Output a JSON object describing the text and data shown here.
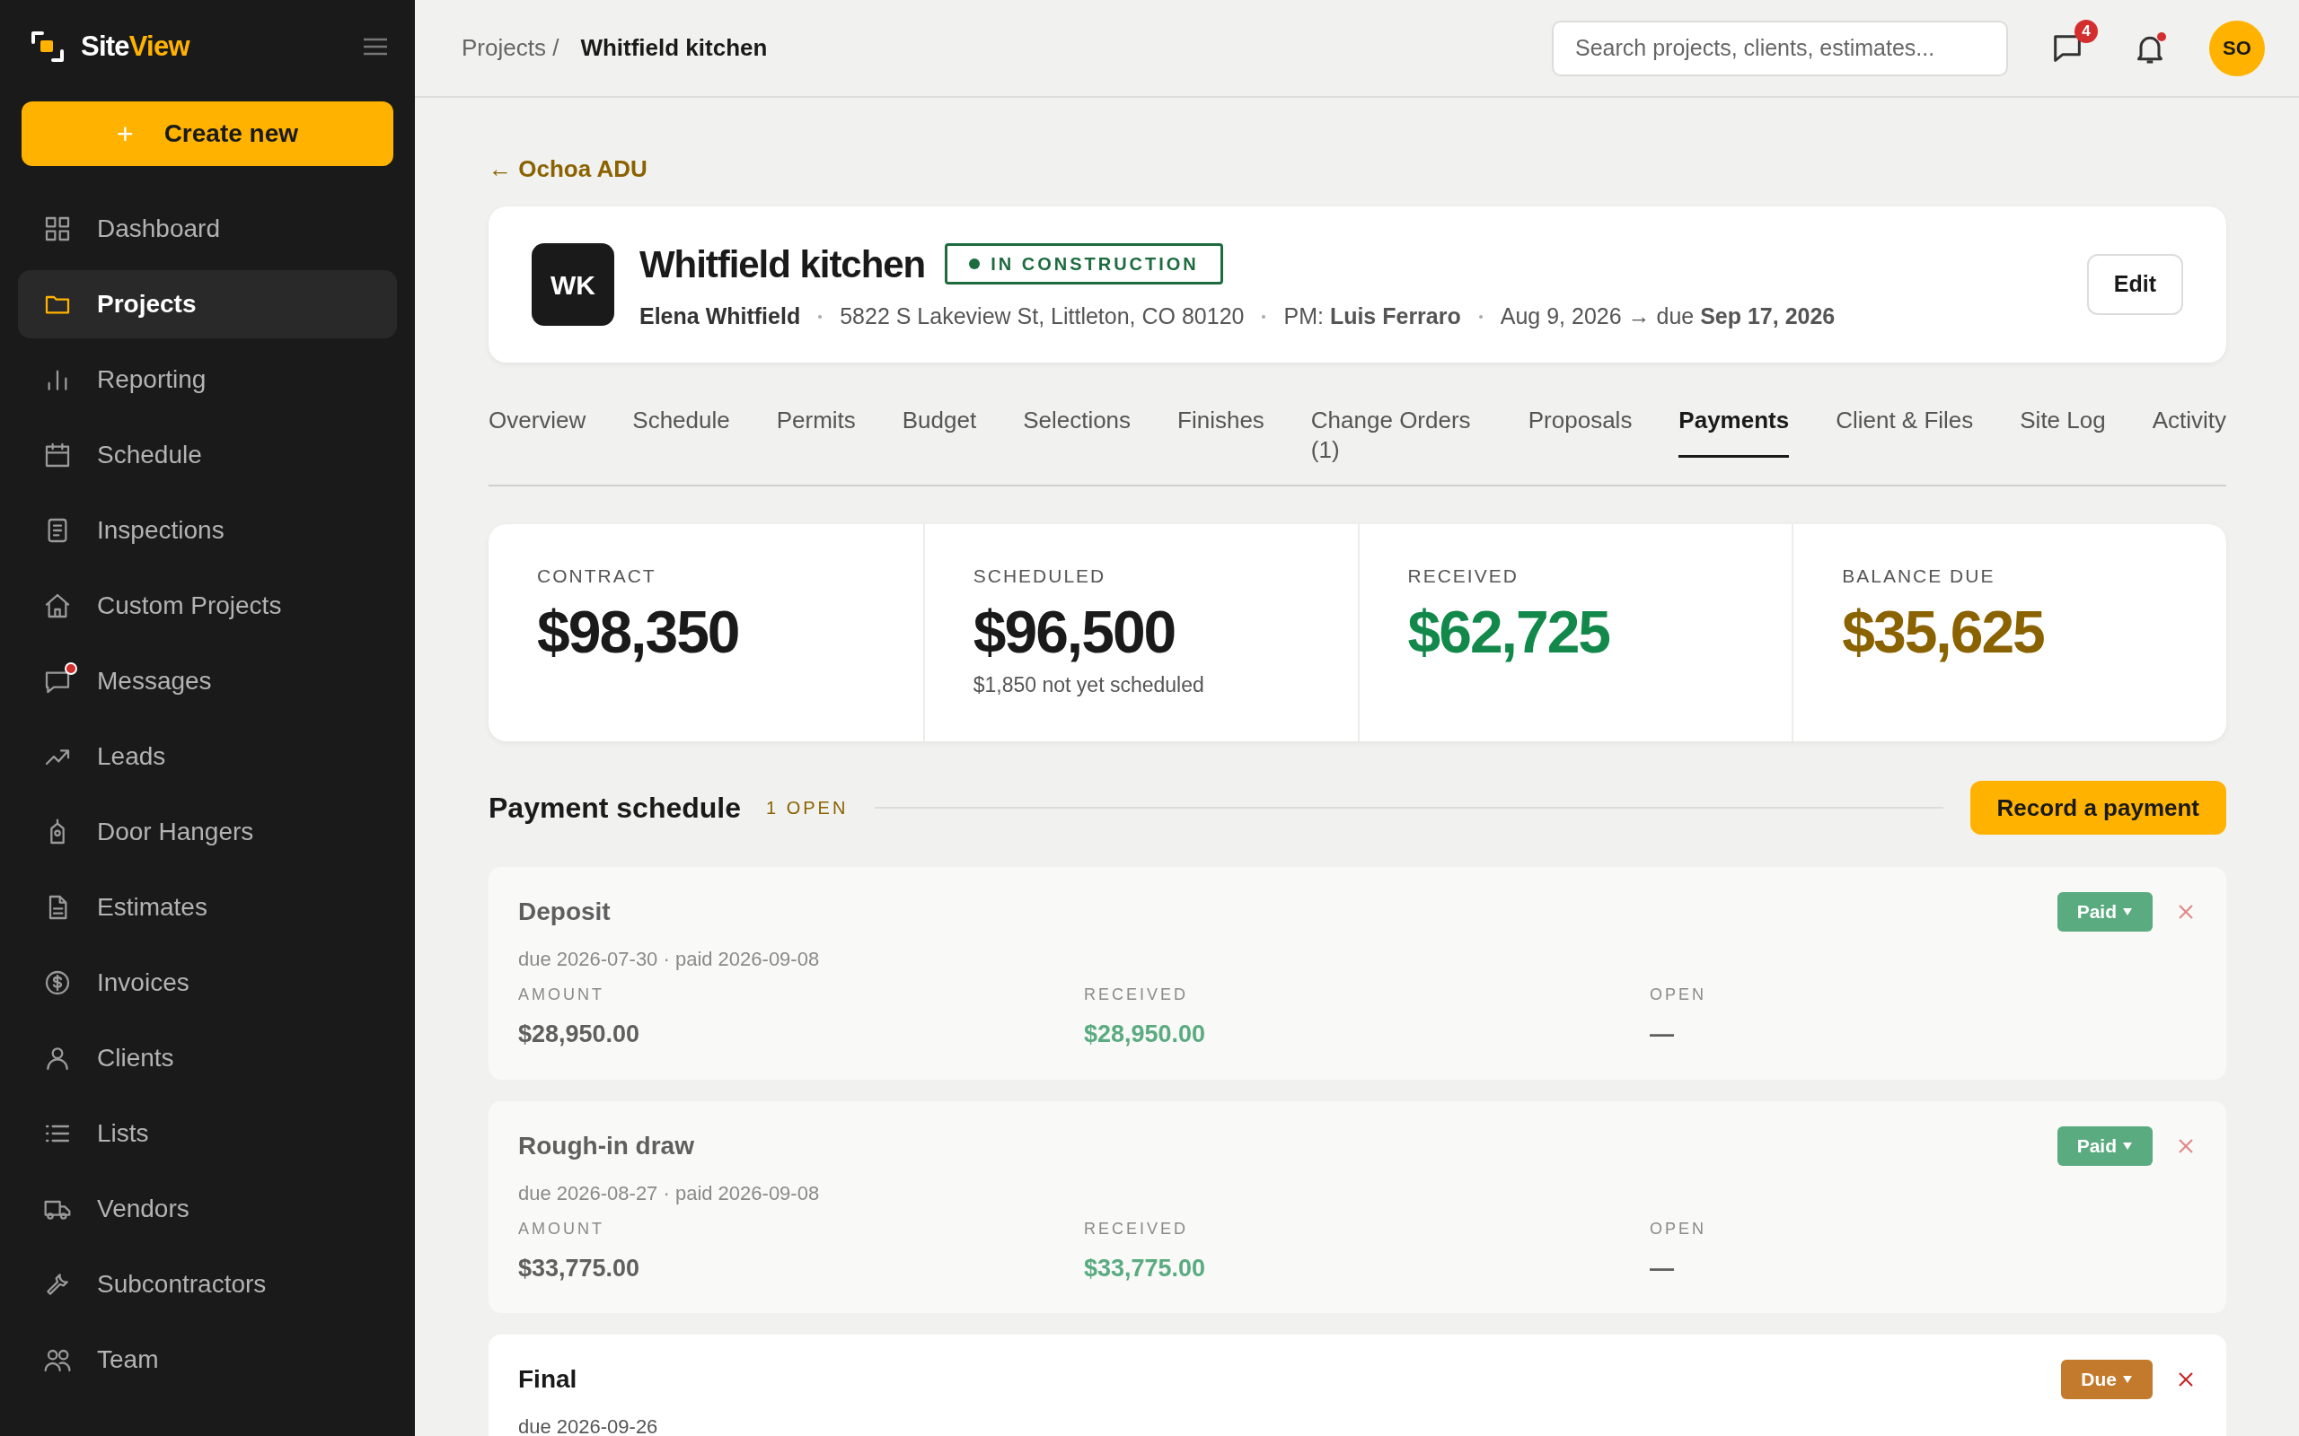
{
  "brand": {
    "prefix": "Site",
    "suffix": "View"
  },
  "sidebar": {
    "create_button": {
      "icon": "+",
      "label": "Create new"
    },
    "items": [
      {
        "label": "Dashboard",
        "selected": false,
        "unread": false
      },
      {
        "label": "Projects",
        "selected": true,
        "unread": false
      },
      {
        "label": "Reporting",
        "selected": false,
        "unread": false
      },
      {
        "label": "Schedule",
        "selected": false,
        "unread": false
      },
      {
        "label": "Inspections",
        "selected": false,
        "unread": false
      },
      {
        "label": "Custom Projects",
        "selected": false,
        "unread": false
      },
      {
        "label": "Messages",
        "selected": false,
        "unread": true
      },
      {
        "label": "Leads",
        "selected": false,
        "unread": false
      },
      {
        "label": "Door Hangers",
        "selected": false,
        "unread": false
      },
      {
        "label": "Estimates",
        "selected": false,
        "unread": false
      },
      {
        "label": "Invoices",
        "selected": false,
        "unread": false
      },
      {
        "label": "Clients",
        "selected": false,
        "unread": false
      },
      {
        "label": "Lists",
        "selected": false,
        "unread": false
      },
      {
        "label": "Vendors",
        "selected": false,
        "unread": false
      },
      {
        "label": "Subcontractors",
        "selected": false,
        "unread": false
      },
      {
        "label": "Team",
        "selected": false,
        "unread": false
      }
    ]
  },
  "topbar": {
    "breadcrumb": {
      "parent": "Projects /",
      "current": "Whitfield kitchen"
    },
    "search": {
      "placeholder": "Search projects, clients, estimates..."
    },
    "messages_badge": "4",
    "notifications_unread": true,
    "avatar": "SO"
  },
  "back_link": "← Ochoa ADU",
  "project": {
    "initials": "WK",
    "title": "Whitfield kitchen",
    "status": "IN CONSTRUCTION",
    "client": "Elena Whitfield",
    "address": "5822 S Lakeview St, Littleton, CO 80120",
    "pm": "PM: **Luis Ferraro**",
    "dates": "Aug 9, 2026 → due **Sep 17, 2026**",
    "edit_button": "Edit"
  },
  "tabs": [
    {
      "label": "Overview",
      "selected": false
    },
    {
      "label": "Schedule",
      "selected": false
    },
    {
      "label": "Permits",
      "selected": false
    },
    {
      "label": "Budget",
      "selected": false
    },
    {
      "label": "Selections",
      "selected": false
    },
    {
      "label": "Finishes",
      "selected": false
    },
    {
      "label": "Change Orders (1)",
      "selected": false
    },
    {
      "label": "Proposals",
      "selected": false
    },
    {
      "label": "Payments",
      "selected": true
    },
    {
      "label": "Client & Files",
      "selected": false
    },
    {
      "label": "Site Log",
      "selected": false
    },
    {
      "label": "Activity",
      "selected": false
    }
  ],
  "stats": [
    {
      "label": "CONTRACT",
      "value": "$98,350",
      "color": "#1a1a1a"
    },
    {
      "label": "SCHEDULED",
      "value": "$96,500",
      "note": "$1,850 not yet scheduled",
      "color": "#1a1a1a"
    },
    {
      "label": "RECEIVED",
      "value": "$62,725",
      "color": "#12894b"
    },
    {
      "label": "BALANCE DUE",
      "value": "$35,625",
      "color": "#8a6200"
    }
  ],
  "payment_schedule": {
    "title": "Payment schedule",
    "open_count": "1 OPEN",
    "record_button": "Record a payment",
    "rows": [
      {
        "name": "Deposit",
        "meta": "due 2026-07-30 · paid 2026-09-08",
        "status": {
          "label": "Paid",
          "kind": "paid"
        },
        "fields": [
          {
            "label": "AMOUNT",
            "value": "$28,950.00",
            "color": "#5f5f5f"
          },
          {
            "label": "RECEIVED",
            "value": "$28,950.00",
            "color": "#5aab80"
          },
          {
            "label": "OPEN",
            "value": "—",
            "color": "#5f5f5f"
          }
        ]
      },
      {
        "name": "Rough-in draw",
        "meta": "due 2026-08-27 · paid 2026-09-08",
        "status": {
          "label": "Paid",
          "kind": "paid"
        },
        "fields": [
          {
            "label": "AMOUNT",
            "value": "$33,775.00",
            "color": "#5f5f5f"
          },
          {
            "label": "RECEIVED",
            "value": "$33,775.00",
            "color": "#5aab80"
          },
          {
            "label": "OPEN",
            "value": "—",
            "color": "#5f5f5f"
          }
        ]
      },
      {
        "name": "Final",
        "meta": "due 2026-09-26",
        "status": {
          "label": "Due",
          "kind": "due"
        }
      }
    ]
  }
}
